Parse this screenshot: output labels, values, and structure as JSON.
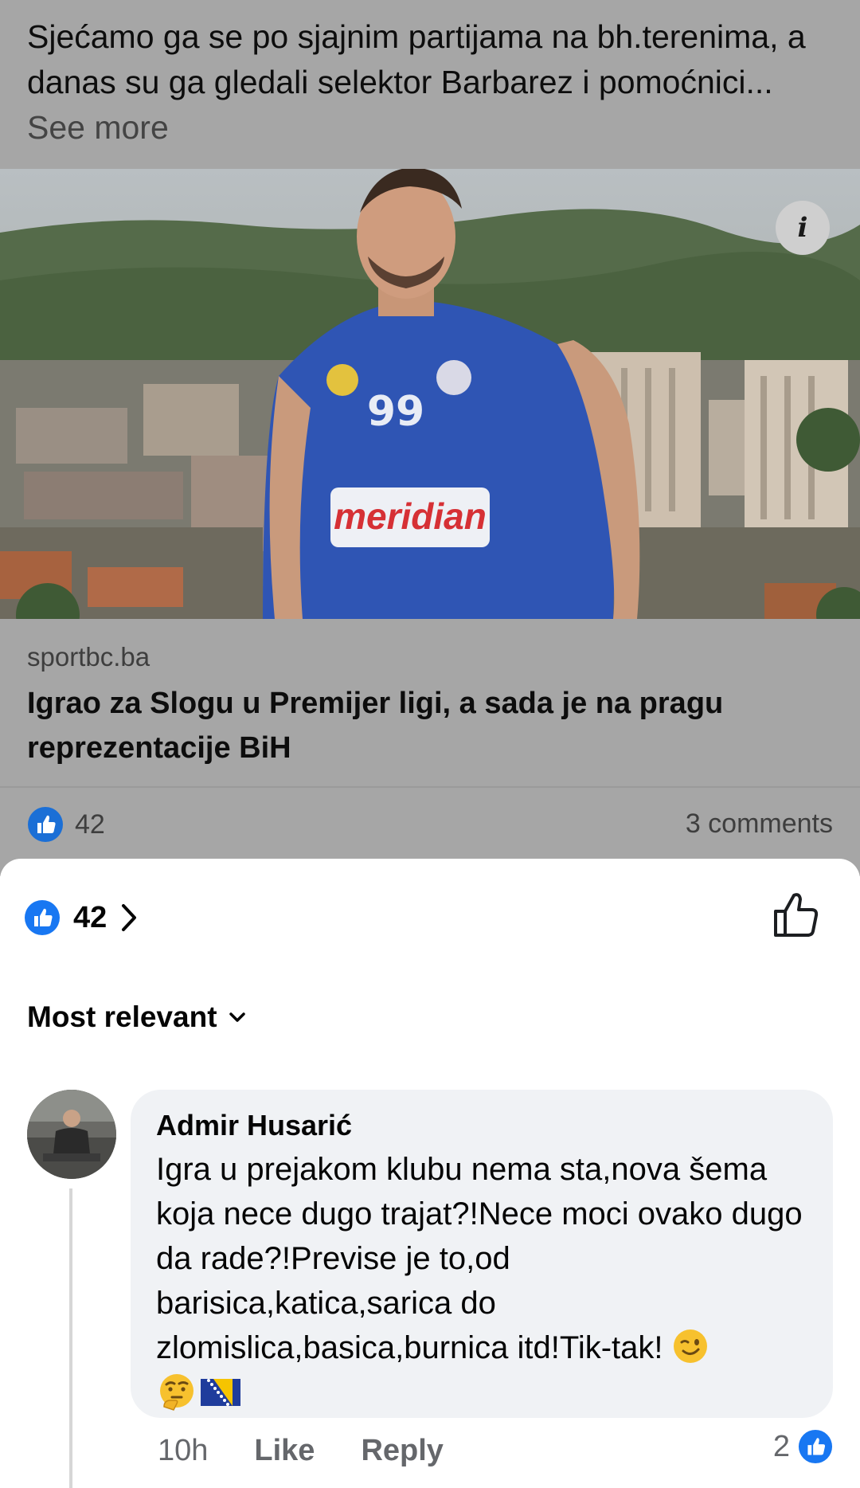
{
  "post": {
    "text": "Sjećamo ga se po sjajnim partijama na bh.terenima, a danas su ga gledali selektor Barbarez i pomoćnici...",
    "see_more": "See more",
    "photo": {
      "jersey_number": "99",
      "sponsor": "meridian",
      "info_label": "i"
    },
    "link": {
      "source": "sportbc.ba",
      "title": "Igrao za Slogu u Premijer ligi, a sada je na pragu reprezentacije BiH"
    },
    "reactions_count": "42",
    "comments_label": "3 comments"
  },
  "sheet": {
    "reactions_count": "42",
    "sort_label": "Most relevant"
  },
  "comment": {
    "author": "Admir Husarić",
    "text": "Igra u prejakom klubu nema sta,nova šema koja nece dugo trajat?!Nece moci ovako dugo da rade?!Previse je to,od barisica,katica,sarica do zlomislica,basica,burnica itd!Tik-tak!",
    "time": "10h",
    "like_label": "Like",
    "reply_label": "Reply",
    "likes_count": "2"
  },
  "colors": {
    "like_blue": "#1877f2",
    "dim_overlay": "#a6a6a6",
    "bubble": "#f0f2f5",
    "meta_gray": "#65676b"
  },
  "icons": [
    "like-reaction-icon",
    "chevron-right-icon",
    "thumbs-up-outline-icon",
    "chevron-down-icon",
    "info-icon",
    "wink-emoji-icon",
    "thinking-emoji-icon",
    "bosnia-flag-icon"
  ]
}
